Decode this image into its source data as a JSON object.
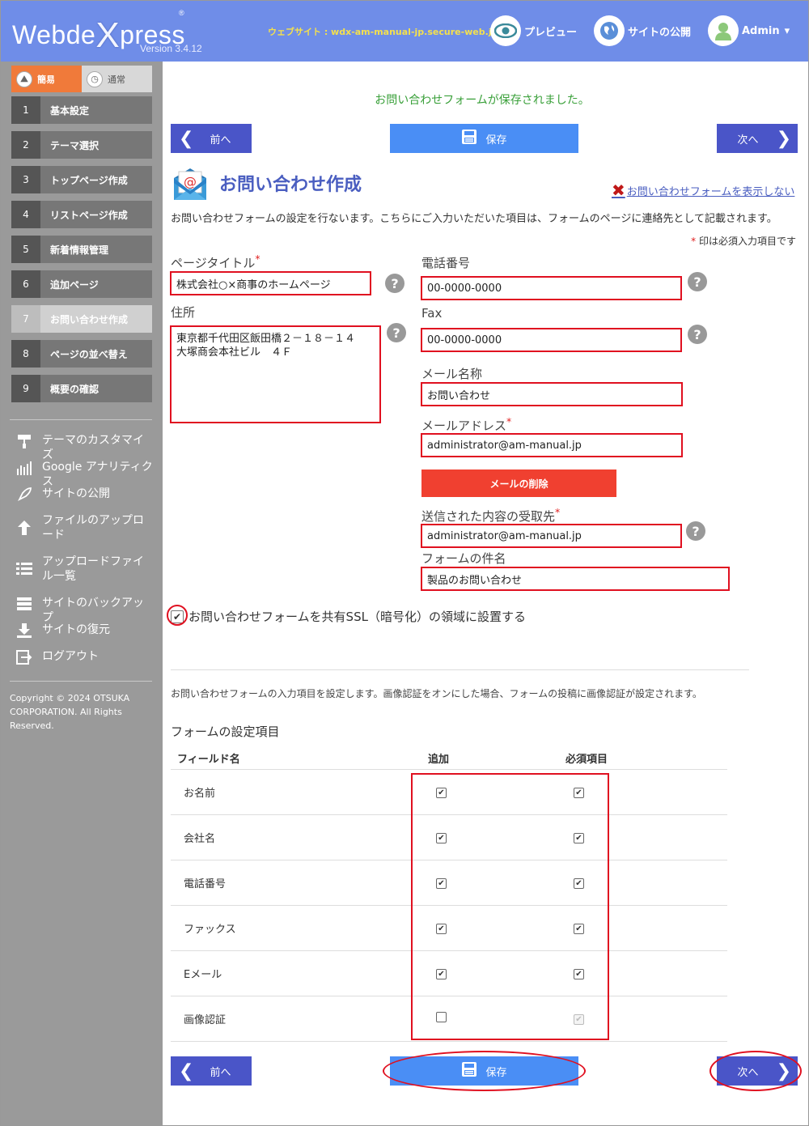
{
  "header": {
    "logo_main": "Webde",
    "logo_x": "X",
    "logo_rest": "press",
    "logo_reg": "®",
    "version": "Version 3.4.12",
    "website": "ウェブサイト : wdx-am-manual-jp.secure-web.jp",
    "preview": "プレビュー",
    "publish": "サイトの公開",
    "admin": "Admin",
    "admin_caret": "▾"
  },
  "sidebar": {
    "mode_easy": "簡易",
    "mode_normal": "通常",
    "steps": [
      {
        "num": "1",
        "label": "基本設定"
      },
      {
        "num": "2",
        "label": "テーマ選択"
      },
      {
        "num": "3",
        "label": "トップページ作成"
      },
      {
        "num": "4",
        "label": "リストページ作成"
      },
      {
        "num": "5",
        "label": "新着情報管理"
      },
      {
        "num": "6",
        "label": "追加ページ"
      },
      {
        "num": "7",
        "label": "お問い合わせ作成"
      },
      {
        "num": "8",
        "label": "ページの並べ替え"
      },
      {
        "num": "9",
        "label": "概要の確認"
      }
    ],
    "tools": [
      "テーマのカスタマイズ",
      "Google アナリティクス",
      "サイトの公開",
      "ファイルのアップロード",
      "アップロードファイル一覧",
      "サイトのバックアップ",
      "サイトの復元",
      "ログアウト"
    ],
    "copyright": "Copyright © 2024 OTSUKA CORPORATION. All Rights Reserved."
  },
  "main": {
    "saved_message": "お問い合わせフォームが保存されました。",
    "prev": "前へ",
    "save": "保存",
    "next": "次へ",
    "title": "お問い合わせ作成",
    "hide_link": "お問い合わせフォームを表示しない",
    "description": "お問い合わせフォームの設定を行ないます。こちらにご入力いただいた項目は、フォームのページに連絡先として記載されます。",
    "required_note": "印は必須入力項目です",
    "required_mark": "*",
    "help": "?",
    "fields": {
      "page_title_label": "ページタイトル",
      "page_title_value": "株式会社○×商事のホームページ",
      "address_label": "住所",
      "address_line1": "東京都千代田区飯田橋２－１８－１４",
      "address_line2": "大塚商会本社ビル　４Ｆ",
      "phone_label": "電話番号",
      "phone_value": "00-0000-0000",
      "fax_label": "Fax",
      "fax_value": "00-0000-0000",
      "mail_name_label": "メール名称",
      "mail_name_value": "お問い合わせ",
      "mail_address_label": "メールアドレス",
      "mail_address_value": "administrator@am-manual.jp",
      "delete_mail": "メールの削除",
      "recipient_label": "送信された内容の受取先",
      "recipient_value": "administrator@am-manual.jp",
      "subject_label": "フォームの件名",
      "subject_value": "製品のお問い合わせ"
    },
    "ssl_label": "お問い合わせフォームを共有SSL（暗号化）の領域に設置する",
    "ssl_checked": true,
    "form_description": "お問い合わせフォームの入力項目を設定します。画像認証をオンにした場合、フォームの投稿に画像認証が設定されます。",
    "form_settings_title": "フォームの設定項目",
    "table_headers": [
      "フィールド名",
      "追加",
      "必須項目"
    ],
    "table_rows": [
      {
        "name": "お名前",
        "add": true,
        "required": true
      },
      {
        "name": "会社名",
        "add": true,
        "required": true
      },
      {
        "name": "電話番号",
        "add": true,
        "required": true
      },
      {
        "name": "ファックス",
        "add": true,
        "required": true
      },
      {
        "name": "Eメール",
        "add": true,
        "required": true
      },
      {
        "name": "画像認証",
        "add": false,
        "required": true
      }
    ]
  },
  "colors": {
    "header_bg": "#6f8de8",
    "sidebar_bg": "#9a9a9a",
    "nav_btn": "#4a55c8",
    "save_btn": "#4a8ef5",
    "highlight": "#e01020",
    "success": "#3aa03a"
  }
}
